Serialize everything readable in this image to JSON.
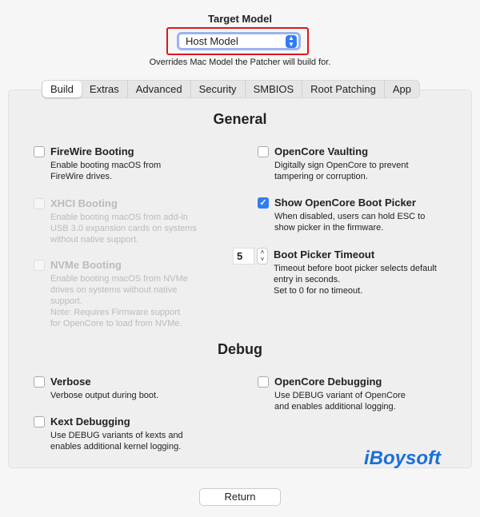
{
  "header": {
    "title": "Target Model",
    "model_value": "Host Model",
    "subtitle": "Overrides Mac Model the Patcher will build for."
  },
  "tabs": [
    {
      "label": "Build",
      "active": true
    },
    {
      "label": "Extras"
    },
    {
      "label": "Advanced"
    },
    {
      "label": "Security"
    },
    {
      "label": "SMBIOS"
    },
    {
      "label": "Root Patching"
    },
    {
      "label": "App"
    }
  ],
  "general": {
    "heading": "General",
    "firewire": {
      "label": "FireWire Booting",
      "desc": "Enable booting macOS from\nFireWire drives.",
      "checked": false
    },
    "xhci": {
      "label": "XHCI Booting",
      "desc": "Enable booting macOS from add-in\nUSB 3.0 expansion cards on systems\nwithout native support.",
      "checked": false,
      "disabled": true
    },
    "nvme": {
      "label": "NVMe Booting",
      "desc": "Enable booting macOS from NVMe\ndrives on systems without native\nsupport.\nNote: Requires Firmware support\nfor OpenCore to load from NVMe.",
      "checked": false,
      "disabled": true
    },
    "vaulting": {
      "label": "OpenCore Vaulting",
      "desc": "Digitally sign OpenCore to prevent\ntampering or corruption.",
      "checked": false
    },
    "bootpicker": {
      "label": "Show OpenCore Boot Picker",
      "desc": "When disabled, users can hold ESC to\nshow picker in the firmware.",
      "checked": true
    },
    "timeout": {
      "label": "Boot Picker Timeout",
      "value": "5",
      "desc": "Timeout before boot picker selects default\nentry in seconds.\nSet to 0 for no timeout."
    }
  },
  "debug": {
    "heading": "Debug",
    "verbose": {
      "label": "Verbose",
      "desc": "Verbose output during boot.",
      "checked": false
    },
    "kext": {
      "label": "Kext Debugging",
      "desc": "Use DEBUG variants of kexts and\nenables additional kernel logging.",
      "checked": false
    },
    "ocdebug": {
      "label": "OpenCore Debugging",
      "desc": "Use DEBUG variant of OpenCore\nand enables additional logging.",
      "checked": false
    }
  },
  "watermark": "iBoysoft",
  "footer": {
    "return_label": "Return"
  },
  "colors": {
    "accent": "#2f7cf6",
    "highlight": "#e0161b"
  }
}
